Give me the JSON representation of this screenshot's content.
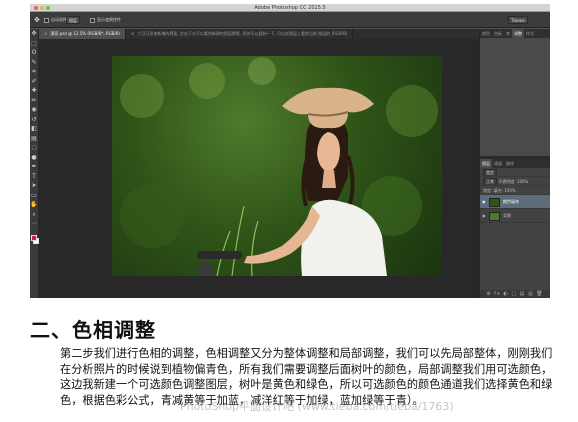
{
  "window": {
    "title": "Adobe Photoshop CC 2015.5"
  },
  "options_bar": {
    "tool_icon": "move-tool-icon",
    "auto_select_label": "自动选择",
    "auto_select_target": "图层",
    "show_transform_label": "显示变换控件",
    "workspace": "Theme"
  },
  "tabs": [
    {
      "label": "漂亮.psd @ 12.5% (RGB/8*, RGB/8)",
      "active": true
    },
    {
      "label": "六日已添加新增的界面, 在右下方可以看到新建的图层蒙版, 而你可以复制一下, 可以在图层上看到当前 图层的 (RGB/8)",
      "active": false
    }
  ],
  "tools": [
    "move-icon",
    "marquee-icon",
    "lasso-icon",
    "quick-select-icon",
    "crop-icon",
    "eyedropper-icon",
    "healing-icon",
    "brush-icon",
    "clone-stamp-icon",
    "history-brush-icon",
    "eraser-icon",
    "gradient-icon",
    "blur-icon",
    "dodge-icon",
    "pen-icon",
    "type-icon",
    "path-select-icon",
    "rectangle-icon",
    "hand-icon",
    "zoom-icon",
    "more-icon"
  ],
  "tool_glyphs": [
    "✥",
    "⬚",
    "ʘ",
    "✎",
    "⌗",
    "✐",
    "✚",
    "✏",
    "◉",
    "↺",
    "◧",
    "▤",
    "◌",
    "●",
    "✒",
    "T",
    "➤",
    "▭",
    "✋",
    "⌕",
    "⋯"
  ],
  "colors": {
    "foreground": "#c81e4a",
    "background": "#ffffff",
    "selection": "#5d6b7a"
  },
  "panels": {
    "top_tabs": [
      "颜色",
      "色板",
      "库",
      "调整",
      "样式"
    ],
    "top_active": 3,
    "bottom_tabs": [
      "图层",
      "通道",
      "路径"
    ],
    "bottom_active": 0,
    "kind_label": "类型",
    "blend_mode": "正常",
    "opacity_label": "不透明度: 100%",
    "lock_label": "锁定:",
    "fill_label": "填充: 100%",
    "layers": [
      {
        "name": "颜色填充",
        "selected": true
      },
      {
        "name": "背景",
        "selected": false
      }
    ],
    "footer_glyphs": "⊕ fx ◐ ▢ ▤ ▥ 🗑"
  },
  "article": {
    "heading": "二、色相调整",
    "paragraph": "第二步我们进行色相的调整，色相调整又分为整体调整和局部调整，我们可以先局部整体，刚刚我们在分析照片的时候说到植物偏青色，所有我们需要调整后面树叶的颜色，局部调整我们用可选颜色，这边我新建一个可选颜色调整图层，树叶是黄色和绿色，所以可选颜色的颜色通道我们选择黄色和绿色，根据色彩公式，青减黄等于加蓝，减洋红等于加绿，蓝加绿等于青）。",
    "watermark": "PhotoShop平面设计吧 (www.tieba.com/tieba/1763)"
  }
}
